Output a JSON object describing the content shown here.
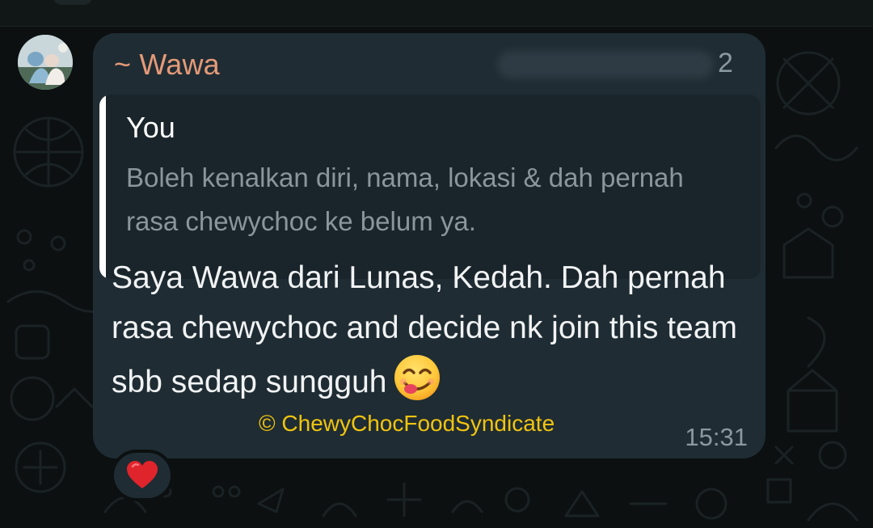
{
  "chat": {
    "message": {
      "sender_name": "~ Wawa",
      "sender_suffix": "2",
      "quoted": {
        "author": "You",
        "text": "Boleh kenalkan diri, nama, lokasi & dah pernah rasa chewychoc ke belum ya."
      },
      "text": "Saya Wawa dari Lunas, Kedah. Dah pernah rasa chewychoc and decide nk join this team sbb sedap sungguh",
      "emoji": "smiling-face-savoring-food-icon",
      "watermark": "© ChewyChocFoodSyndicate",
      "time": "15:31",
      "reaction": "red-heart-icon"
    }
  },
  "colors": {
    "background": "#0c1011",
    "bubble": "#1f2c33",
    "quote_background": "#1a252b",
    "sender_name": "#e59a78",
    "watermark": "#f1c40f",
    "message_text": "#f1f3f4",
    "secondary_text": "#8a989f",
    "reaction_heart": "#e0242c"
  }
}
